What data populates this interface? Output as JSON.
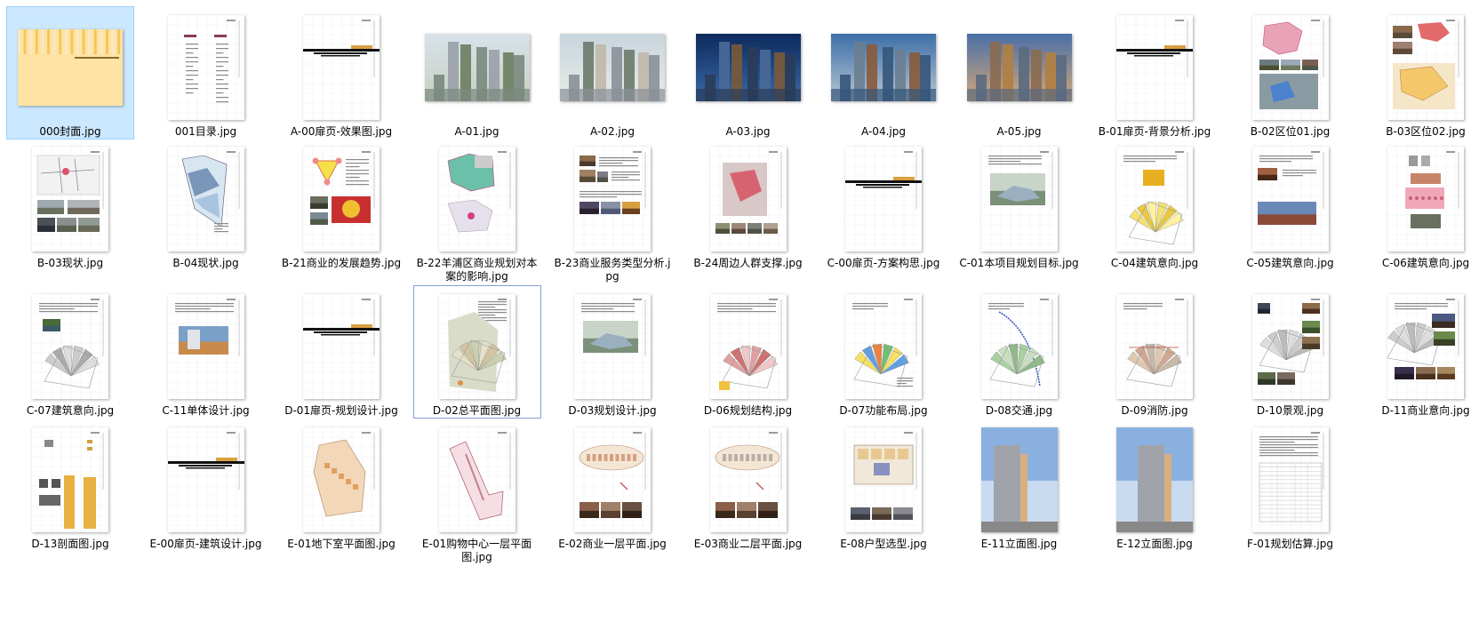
{
  "files": [
    {
      "name": "000封面.jpg",
      "kind": "cover",
      "selected": true
    },
    {
      "name": "001目录.jpg",
      "kind": "toc"
    },
    {
      "name": "A-00扉页-效果图.jpg",
      "kind": "divider"
    },
    {
      "name": "A-01.jpg",
      "kind": "render-day"
    },
    {
      "name": "A-02.jpg",
      "kind": "render-day2"
    },
    {
      "name": "A-03.jpg",
      "kind": "render-night"
    },
    {
      "name": "A-04.jpg",
      "kind": "render-dusk"
    },
    {
      "name": "A-05.jpg",
      "kind": "render-dusk2"
    },
    {
      "name": "B-01扉页-背景分析.jpg",
      "kind": "divider"
    },
    {
      "name": "B-02区位01.jpg",
      "kind": "map-pink"
    },
    {
      "name": "B-03区位02.jpg",
      "kind": "map-photos"
    },
    {
      "name": "B-03现状.jpg",
      "kind": "photos-map"
    },
    {
      "name": "B-04现状.jpg",
      "kind": "site-blue"
    },
    {
      "name": "B-21商业的发展趋势.jpg",
      "kind": "diagram-yellow"
    },
    {
      "name": "B-22羊浦区商业规划对本案的影响.jpg",
      "kind": "map-teal"
    },
    {
      "name": "B-23商业服务类型分析.jpg",
      "kind": "photos-text"
    },
    {
      "name": "B-24周边人群支撑.jpg",
      "kind": "map-red"
    },
    {
      "name": "C-00扉页-方案构思.jpg",
      "kind": "divider"
    },
    {
      "name": "C-01本项目规划目标.jpg",
      "kind": "render-small"
    },
    {
      "name": "C-04建筑意向.jpg",
      "kind": "plan-yellow"
    },
    {
      "name": "C-05建筑意向.jpg",
      "kind": "photos-building"
    },
    {
      "name": "C-06建筑意向.jpg",
      "kind": "pattern-pink"
    },
    {
      "name": "C-07建筑意向.jpg",
      "kind": "plan-green"
    },
    {
      "name": "C-11单体设计.jpg",
      "kind": "render-small2"
    },
    {
      "name": "D-01扉页-规划设计.jpg",
      "kind": "divider"
    },
    {
      "name": "D-02总平面图.jpg",
      "kind": "masterplan",
      "focused": true
    },
    {
      "name": "D-03规划设计.jpg",
      "kind": "render-small"
    },
    {
      "name": "D-06规划结构.jpg",
      "kind": "plan-red"
    },
    {
      "name": "D-07功能布局.jpg",
      "kind": "plan-color"
    },
    {
      "name": "D-08交通.jpg",
      "kind": "plan-blue"
    },
    {
      "name": "D-09消防.jpg",
      "kind": "plan-brown"
    },
    {
      "name": "D-10景观.jpg",
      "kind": "plan-photos"
    },
    {
      "name": "D-11商业意向.jpg",
      "kind": "plan-photos2"
    },
    {
      "name": "D-13剖面图.jpg",
      "kind": "section"
    },
    {
      "name": "E-00扉页-建筑设计.jpg",
      "kind": "divider"
    },
    {
      "name": "E-01地下室平面图.jpg",
      "kind": "floor-orange"
    },
    {
      "name": "E-01购物中心一层平面图.jpg",
      "kind": "floor-pink"
    },
    {
      "name": "E-02商业一层平面.jpg",
      "kind": "floor-ellipse"
    },
    {
      "name": "E-03商业二层平面.jpg",
      "kind": "floor-ellipse2"
    },
    {
      "name": "E-08户型选型.jpg",
      "kind": "floor-unit"
    },
    {
      "name": "E-11立面图.jpg",
      "kind": "elevation"
    },
    {
      "name": "E-12立面图.jpg",
      "kind": "elevation2"
    },
    {
      "name": "F-01规划估算.jpg",
      "kind": "table"
    }
  ]
}
